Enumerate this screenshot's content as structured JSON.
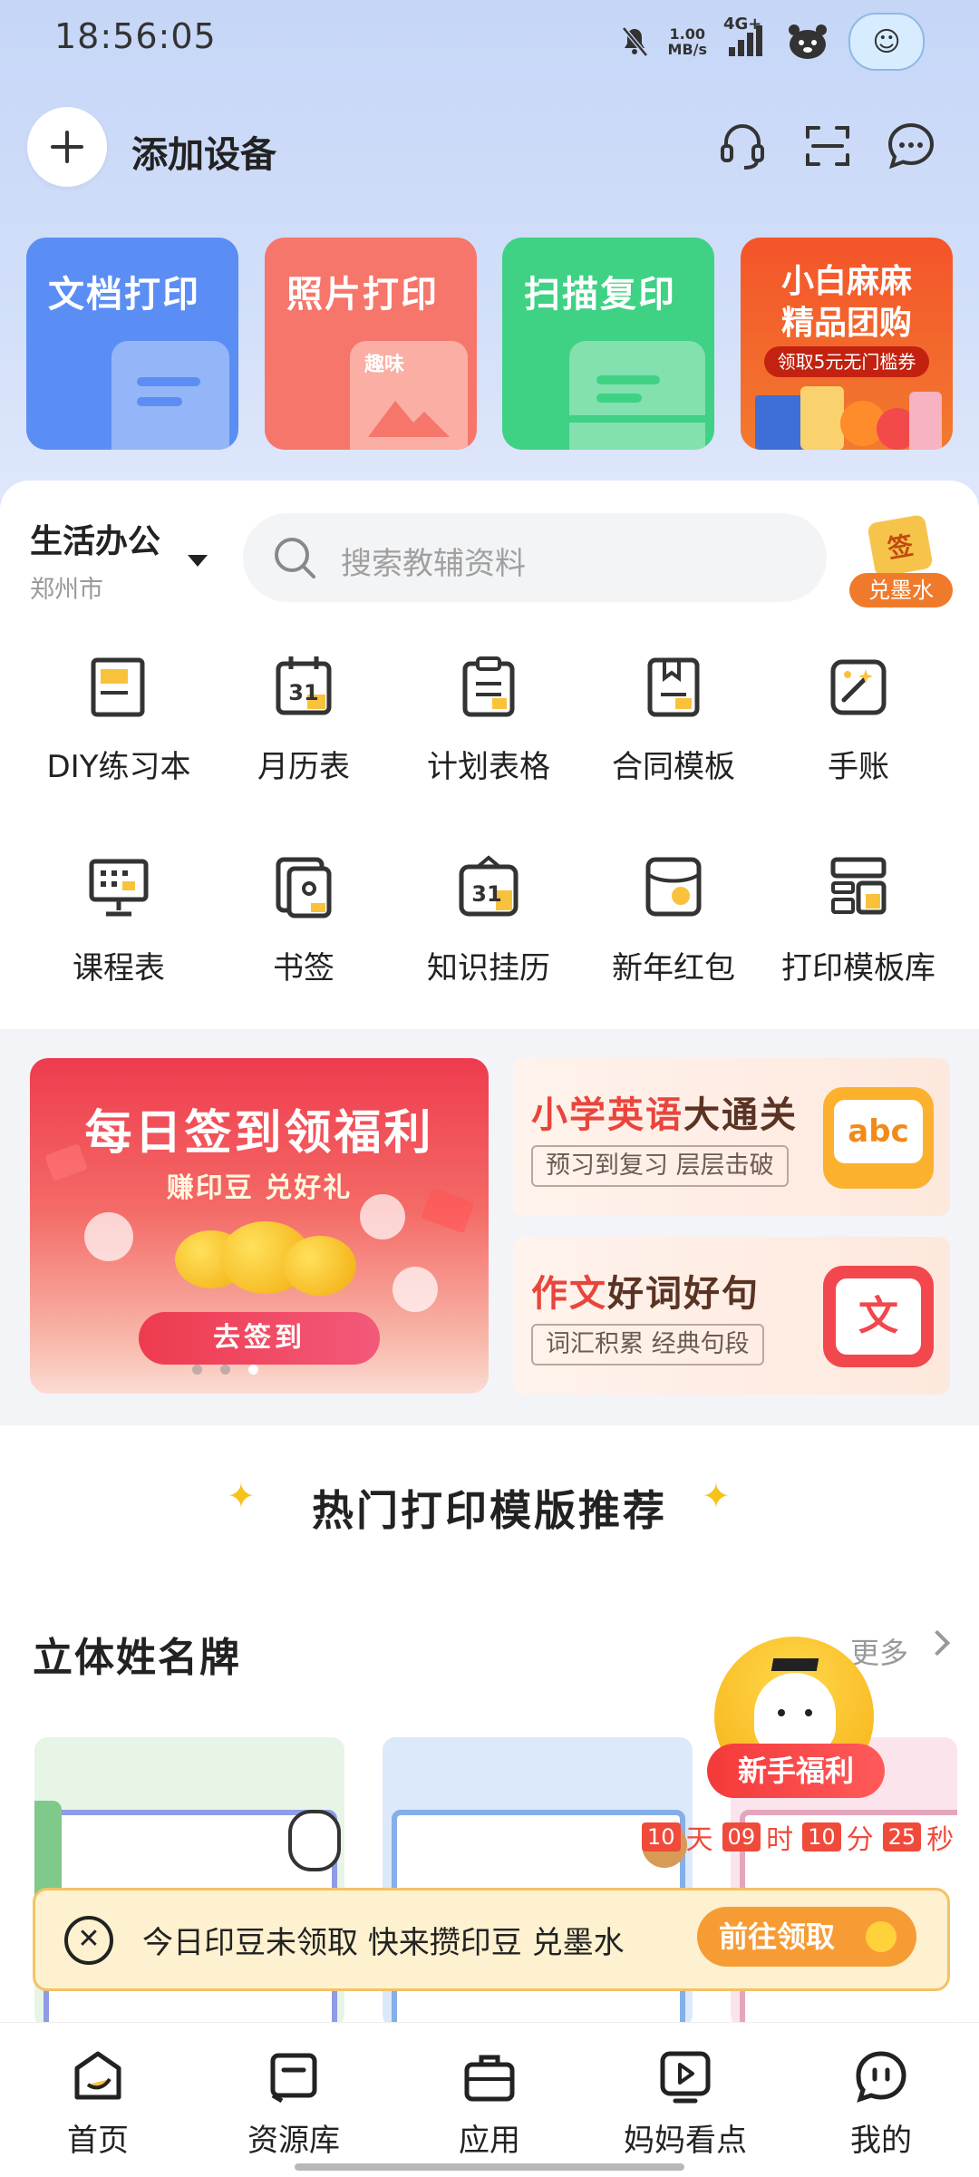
{
  "status_bar": {
    "time": "18:56:05",
    "speed_value": "1.00",
    "speed_unit": "MB/s",
    "network": "4G+"
  },
  "header": {
    "add_device_label": "添加设备"
  },
  "feature_cards": [
    {
      "label": "文档打印",
      "color": "#5b8ef5"
    },
    {
      "label": "照片打印",
      "color": "#f6766c",
      "tag": "趣味"
    },
    {
      "label": "扫描复印",
      "color": "#3fd184"
    },
    {
      "label_line1": "小白麻麻",
      "label_line2": "精品团购",
      "promo": "领取5元无门槛券",
      "color": "#f35a2a"
    }
  ],
  "location": {
    "category": "生活办公",
    "city": "郑州市"
  },
  "search": {
    "placeholder": "搜索教辅资料"
  },
  "sign_badge": {
    "icon_text": "签",
    "label": "兑墨水"
  },
  "grid": [
    {
      "label": "DIY练习本",
      "icon": "notebook-icon"
    },
    {
      "label": "月历表",
      "icon": "calendar-icon",
      "glyph": "31"
    },
    {
      "label": "计划表格",
      "icon": "clipboard-icon"
    },
    {
      "label": "合同模板",
      "icon": "contract-icon"
    },
    {
      "label": "手账",
      "icon": "journal-icon"
    },
    {
      "label": "课程表",
      "icon": "schedule-board-icon"
    },
    {
      "label": "书签",
      "icon": "bookmark-icon"
    },
    {
      "label": "知识挂历",
      "icon": "wall-calendar-icon",
      "glyph": "31"
    },
    {
      "label": "新年红包",
      "icon": "red-envelope-icon"
    },
    {
      "label": "打印模板库",
      "icon": "template-library-icon"
    }
  ],
  "banner_main": {
    "title": "每日签到领福利",
    "subtitle": "赚印豆  兑好礼",
    "button": "去签到"
  },
  "banner_side": [
    {
      "title_hl": "小学英语",
      "title_rest": "大通关",
      "subtitle": "预习到复习 层层击破",
      "art_text": "abc"
    },
    {
      "title_hl": "作文",
      "title_rest": "好词好句",
      "subtitle": "词汇积累  经典句段",
      "art_text": "文"
    }
  ],
  "hot_section": {
    "title": "热门打印模版推荐"
  },
  "name_card_row": {
    "title": "立体姓名牌",
    "more": "更多"
  },
  "welfare": {
    "label": "新手福利"
  },
  "countdown": {
    "days": "10",
    "days_unit": "天",
    "hours": "09",
    "hours_unit": "时",
    "minutes": "10",
    "minutes_unit": "分",
    "seconds": "25",
    "seconds_unit": "秒"
  },
  "toast": {
    "message": "今日印豆未领取 快来攒印豆 兑墨水",
    "button": "前往领取"
  },
  "tabbar": [
    {
      "label": "首页",
      "icon": "home-icon",
      "active": true
    },
    {
      "label": "资源库",
      "icon": "library-icon"
    },
    {
      "label": "应用",
      "icon": "briefcase-icon"
    },
    {
      "label": "妈妈看点",
      "icon": "video-play-icon"
    },
    {
      "label": "我的",
      "icon": "profile-face-icon"
    }
  ]
}
